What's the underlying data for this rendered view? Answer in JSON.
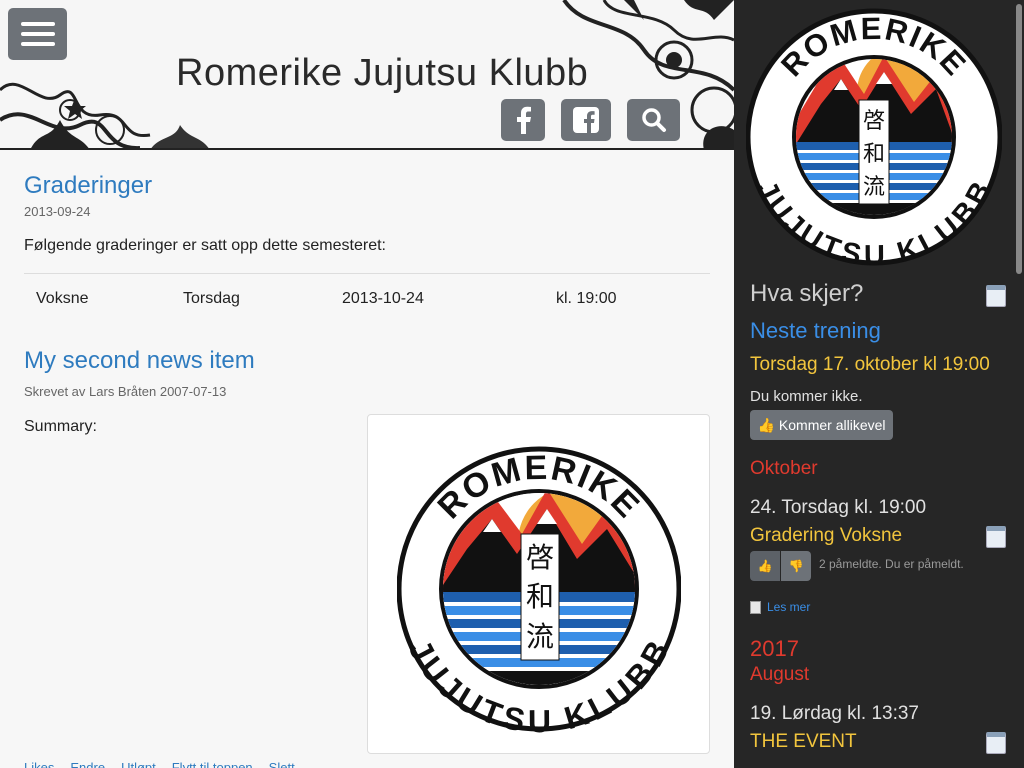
{
  "header": {
    "site_title": "Romerike Jujutsu Klubb"
  },
  "main": {
    "news1": {
      "title": "Graderinger",
      "date": "2013-09-24",
      "intro": "Følgende graderinger er satt opp dette semesteret:",
      "rows": [
        {
          "group": "Voksne",
          "day": "Torsdag",
          "date": "2013-10-24",
          "time": "kl. 19:00"
        }
      ]
    },
    "news2": {
      "title": "My second news item",
      "meta": "Skrevet av Lars Bråten 2007-07-13",
      "summary": "Summary:"
    },
    "actions": [
      "Likes",
      "Endre",
      "Utløpt",
      "Flytt til toppen",
      "Slett"
    ]
  },
  "logo": {
    "top_text": "ROMERIKE",
    "bottom_text": "JUJUTSU KLUBB",
    "kanji": [
      "啓",
      "和",
      "流"
    ]
  },
  "sidebar": {
    "heading": "Hva skjer?",
    "next_training_label": "Neste trening",
    "next_training_date": "Torsdag 17. oktober kl 19:00",
    "attendance_note": "Du kommer ikke.",
    "attend_button": "Kommer allikevel",
    "month1": "Oktober",
    "event1_day": "24. Torsdag kl. 19:00",
    "event1_name": "Gradering Voksne",
    "event1_signups": "2 påmeldte. Du er påmeldt.",
    "read_more": "Les mer",
    "year2": "2017",
    "month2": "August",
    "event2_day": "19. Lørdag kl. 13:37",
    "event2_name": "THE EVENT"
  },
  "colors": {
    "link_blue": "#2e7bbf",
    "accent_yellow": "#f2c53d",
    "accent_red": "#e03a2e",
    "button_gray": "#6d7278",
    "sidebar_bg": "#262626"
  }
}
